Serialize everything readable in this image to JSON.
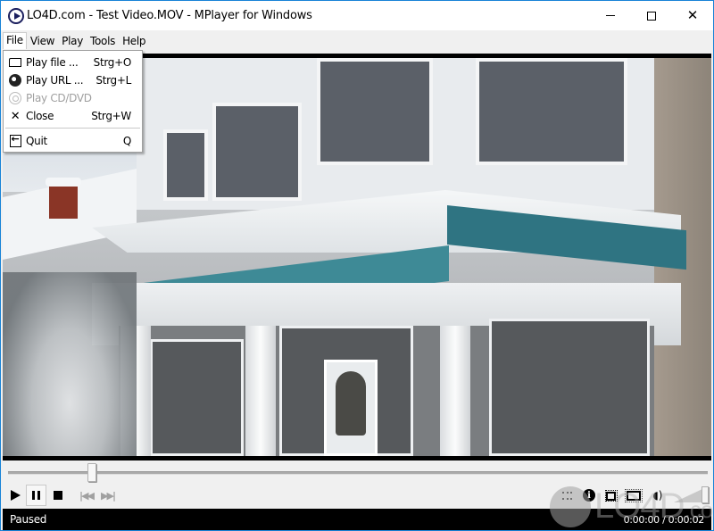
{
  "window": {
    "title": "LO4D.com - Test Video.MOV - MPlayer for Windows",
    "app_icon": "play-circle-icon",
    "controls": {
      "minimize": "minimize-icon",
      "maximize": "maximize-icon",
      "close_glyph": "✕"
    }
  },
  "menubar": {
    "items": [
      {
        "label": "File",
        "open": true
      },
      {
        "label": "View"
      },
      {
        "label": "Play"
      },
      {
        "label": "Tools"
      },
      {
        "label": "Help"
      }
    ]
  },
  "file_menu": {
    "items": [
      {
        "label": "Play file ...",
        "shortcut": "Strg+O",
        "icon": "open-folder-icon",
        "enabled": true
      },
      {
        "label": "Play URL ...",
        "shortcut": "Strg+L",
        "icon": "globe-icon",
        "enabled": true
      },
      {
        "label": "Play CD/DVD",
        "shortcut": "",
        "icon": "cd-icon",
        "enabled": false
      },
      {
        "label": "Close",
        "shortcut": "Strg+W",
        "icon": "close-x-icon",
        "enabled": true
      },
      {
        "label": "Quit",
        "shortcut": "Q",
        "icon": "exit-icon",
        "enabled": true
      }
    ]
  },
  "video": {
    "description": "Snow-covered house with teal trim porch"
  },
  "seek": {
    "progress_percent": 12
  },
  "playback_controls": {
    "play": "play-icon",
    "pause": "pause-icon",
    "stop": "stop-icon",
    "previous": "skip-back-icon",
    "next": "skip-forward-icon",
    "prev_glyph": "|◀◀",
    "next_glyph": "▶▶|",
    "pause_pressed": true
  },
  "right_controls": {
    "playlist": "playlist-icon",
    "info": "info-icon",
    "info_glyph": "i",
    "resize": "resize-icon",
    "fullscreen": "fullscreen-icon",
    "mute": "speaker-icon",
    "speaker_glyph": "◖)"
  },
  "volume": {
    "level_percent": 90
  },
  "status": {
    "state": "Paused",
    "time": "0:00:00 / 0:00:02"
  },
  "watermark": {
    "text": "LO4D",
    "suffix": ".com"
  }
}
